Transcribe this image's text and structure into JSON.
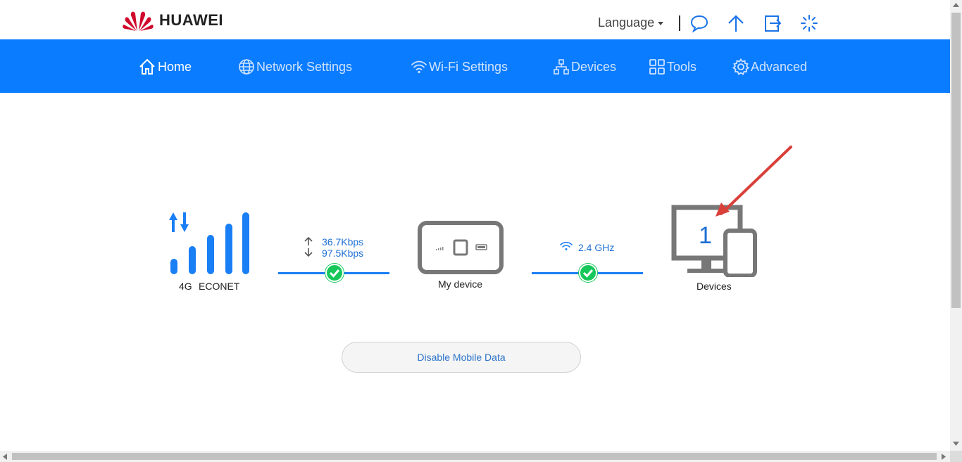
{
  "header": {
    "brand": "HUAWEI",
    "language_label": "Language",
    "icons": [
      "message-icon",
      "upload-icon",
      "logout-icon",
      "loading-icon"
    ]
  },
  "nav": {
    "items": [
      {
        "label": "Home",
        "icon": "home-icon",
        "active": true
      },
      {
        "label": "Network Settings",
        "icon": "globe-icon",
        "active": false
      },
      {
        "label": "Wi-Fi Settings",
        "icon": "wifi-icon",
        "active": false
      },
      {
        "label": "Devices",
        "icon": "network-icon",
        "active": false
      },
      {
        "label": "Tools",
        "icon": "tools-icon",
        "active": false
      },
      {
        "label": "Advanced",
        "icon": "gear-icon",
        "active": false
      }
    ]
  },
  "status": {
    "network_type": "4G",
    "operator": "ECONET",
    "upload_speed": "36.7Kbps",
    "download_speed": "97.5Kbps",
    "router_label": "My device",
    "wifi_band": "2.4 GHz",
    "devices_count": "1",
    "devices_label": "Devices"
  },
  "actions": {
    "disable_data_label": "Disable Mobile Data"
  },
  "colors": {
    "brand_blue": "#0a7cff",
    "check_green": "#16c75a",
    "arrow_red": "#d9403a"
  }
}
